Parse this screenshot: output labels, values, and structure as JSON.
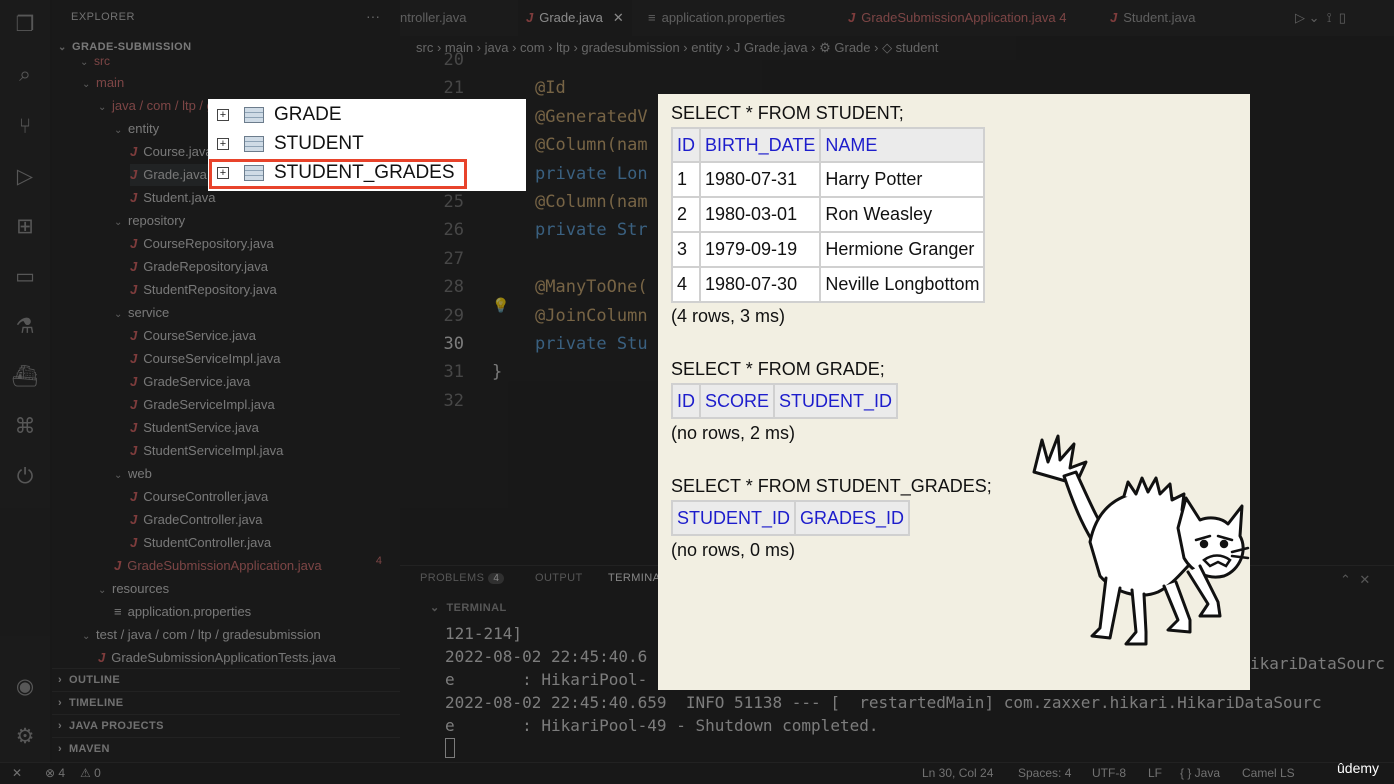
{
  "window": {
    "title": "GradeSubmissionApplication"
  },
  "sidebar": {
    "title": "EXPLORER",
    "project": "GRADE-SUBMISSION",
    "tree": [
      {
        "label": "main",
        "indent": 1,
        "type": "folder-open",
        "red": true
      },
      {
        "label": "java / com / ltp / gr...",
        "indent": 2,
        "type": "folder-open",
        "red": true
      },
      {
        "label": "entity",
        "indent": 3,
        "type": "folder-open"
      },
      {
        "label": "Course.java",
        "indent": 4,
        "type": "java"
      },
      {
        "label": "Grade.java",
        "indent": 4,
        "type": "java",
        "selected": true
      },
      {
        "label": "Student.java",
        "indent": 4,
        "type": "java"
      },
      {
        "label": "repository",
        "indent": 3,
        "type": "folder-open"
      },
      {
        "label": "CourseRepository.java",
        "indent": 4,
        "type": "java"
      },
      {
        "label": "GradeRepository.java",
        "indent": 4,
        "type": "java"
      },
      {
        "label": "StudentRepository.java",
        "indent": 4,
        "type": "java"
      },
      {
        "label": "service",
        "indent": 3,
        "type": "folder-open"
      },
      {
        "label": "CourseService.java",
        "indent": 4,
        "type": "java"
      },
      {
        "label": "CourseServiceImpl.java",
        "indent": 4,
        "type": "java"
      },
      {
        "label": "GradeService.java",
        "indent": 4,
        "type": "java"
      },
      {
        "label": "GradeServiceImpl.java",
        "indent": 4,
        "type": "java"
      },
      {
        "label": "StudentService.java",
        "indent": 4,
        "type": "java"
      },
      {
        "label": "StudentServiceImpl.java",
        "indent": 4,
        "type": "java"
      },
      {
        "label": "web",
        "indent": 3,
        "type": "folder-open"
      },
      {
        "label": "CourseController.java",
        "indent": 4,
        "type": "java"
      },
      {
        "label": "GradeController.java",
        "indent": 4,
        "type": "java"
      },
      {
        "label": "StudentController.java",
        "indent": 4,
        "type": "java"
      },
      {
        "label": "GradeSubmissionApplication.java",
        "indent": 3,
        "type": "java",
        "red": true,
        "badge": "4"
      },
      {
        "label": "resources",
        "indent": 2,
        "type": "folder-open"
      },
      {
        "label": "application.properties",
        "indent": 3,
        "type": "props"
      },
      {
        "label": "test / java / com / ltp / gradesubmission",
        "indent": 1,
        "type": "folder-open"
      },
      {
        "label": "GradeSubmissionApplicationTests.java",
        "indent": 2,
        "type": "java"
      }
    ],
    "sections": [
      "OUTLINE",
      "TIMELINE",
      "JAVA PROJECTS",
      "MAVEN"
    ]
  },
  "tabs": [
    {
      "label": "ntroller.java",
      "icon": "",
      "active": false
    },
    {
      "label": "Grade.java",
      "icon": "J",
      "active": true
    },
    {
      "label": "application.properties",
      "icon": "≡",
      "active": false
    },
    {
      "label": "GradeSubmissionApplication.java 4",
      "icon": "J",
      "active": false,
      "red": true
    },
    {
      "label": "Student.java",
      "icon": "J",
      "active": false
    }
  ],
  "breadcrumbs": "src › main › java › com › ltp › gradesubmission › entity › J Grade.java › ⚙ Grade › ◇ student",
  "code": {
    "line_numbers": [
      "20",
      "21",
      "22",
      "23",
      "24",
      "25",
      "26",
      "27",
      "28",
      "29",
      "30",
      "31",
      "32"
    ],
    "lines": [
      "",
      "@Id",
      "@GeneratedV",
      "@Column(nam",
      "private Lon",
      "@Column(nam",
      "private Str",
      "",
      "@ManyToOne(",
      "@JoinColumn",
      "private Stu",
      "}",
      ""
    ]
  },
  "panel": {
    "tabs": [
      "PROBLEMS",
      "OUTPUT",
      "TERMINA"
    ],
    "problems_badge": "4",
    "terminal_label": "TERMINAL",
    "lines": [
      "121-214]",
      "2022-08-02 22:45:40.6",
      "e       : HikariPool-",
      "2022-08-02 22:45:40.659  INFO 51138 --- [  restartedMain] com.zaxxer.hikari.HikariDataSourc",
      "e       : HikariPool-49 - Shutdown completed.",
      ""
    ],
    "right_fragment": "ikariDataSourc"
  },
  "status": {
    "errors": "⊗ 4",
    "warnings": "⚠ 0",
    "position": "Ln 30, Col 24",
    "spaces": "Spaces: 4",
    "encoding": "UTF-8",
    "eol": "LF",
    "language": "{ } Java",
    "camel": "Camel LS",
    "brand": "ûdemy"
  },
  "db_tree": {
    "items": [
      "GRADE",
      "STUDENT",
      "STUDENT_GRADES"
    ],
    "highlighted": "STUDENT_GRADES"
  },
  "results": {
    "student": {
      "query": "SELECT * FROM STUDENT;",
      "columns": [
        "ID",
        "BIRTH_DATE",
        "NAME"
      ],
      "rows": [
        [
          "1",
          "1980-07-31",
          "Harry Potter"
        ],
        [
          "2",
          "1980-03-01",
          "Ron Weasley"
        ],
        [
          "3",
          "1979-09-19",
          "Hermione Granger"
        ],
        [
          "4",
          "1980-07-30",
          "Neville Longbottom"
        ]
      ],
      "info": "(4 rows, 3 ms)"
    },
    "grade": {
      "query": "SELECT * FROM GRADE;",
      "columns": [
        "ID",
        "SCORE",
        "STUDENT_ID"
      ],
      "rows": [],
      "info": "(no rows, 2 ms)"
    },
    "student_grades": {
      "query": "SELECT * FROM STUDENT_GRADES;",
      "columns": [
        "STUDENT_ID",
        "GRADES_ID"
      ],
      "rows": [],
      "info": "(no rows, 0 ms)"
    }
  },
  "colors": {
    "highlight": "#e8432b",
    "header_text": "#1d1dcc",
    "result_bg": "#f2efe2"
  }
}
